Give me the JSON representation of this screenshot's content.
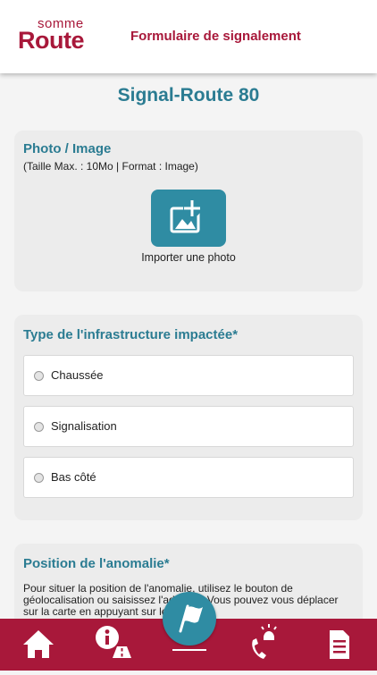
{
  "header": {
    "logo_top": "somme",
    "logo_main": "Route",
    "title": "Formulaire de signalement"
  },
  "page_title": "Signal-Route 80",
  "photo_section": {
    "title": "Photo / Image",
    "hint": "(Taille Max. : 10Mo | Format : Image)",
    "button_label": "Importer une photo"
  },
  "type_section": {
    "title": "Type de l'infrastructure impactée*",
    "options": [
      {
        "label": "Chaussée",
        "checked": false
      },
      {
        "label": "Signalisation",
        "checked": false
      },
      {
        "label": "Bas côté",
        "checked": false
      }
    ]
  },
  "position_section": {
    "title": "Position de l'anomalie*",
    "text": "Pour situer la position de l'anomalie, utilisez le bouton de géolocalisation ou saisissez l'adresse. Vous pouvez vous déplacer sur la carte en appuyant sur le cadenas."
  },
  "bottom_nav": {
    "items": [
      {
        "icon": "home-icon"
      },
      {
        "icon": "info-road-icon"
      },
      {
        "icon": "flag-icon",
        "active": true
      },
      {
        "icon": "emergency-call-icon"
      },
      {
        "icon": "document-icon"
      }
    ]
  },
  "colors": {
    "brand": "#a8183a",
    "accent": "#2b7c92",
    "button": "#2f8ca3"
  }
}
